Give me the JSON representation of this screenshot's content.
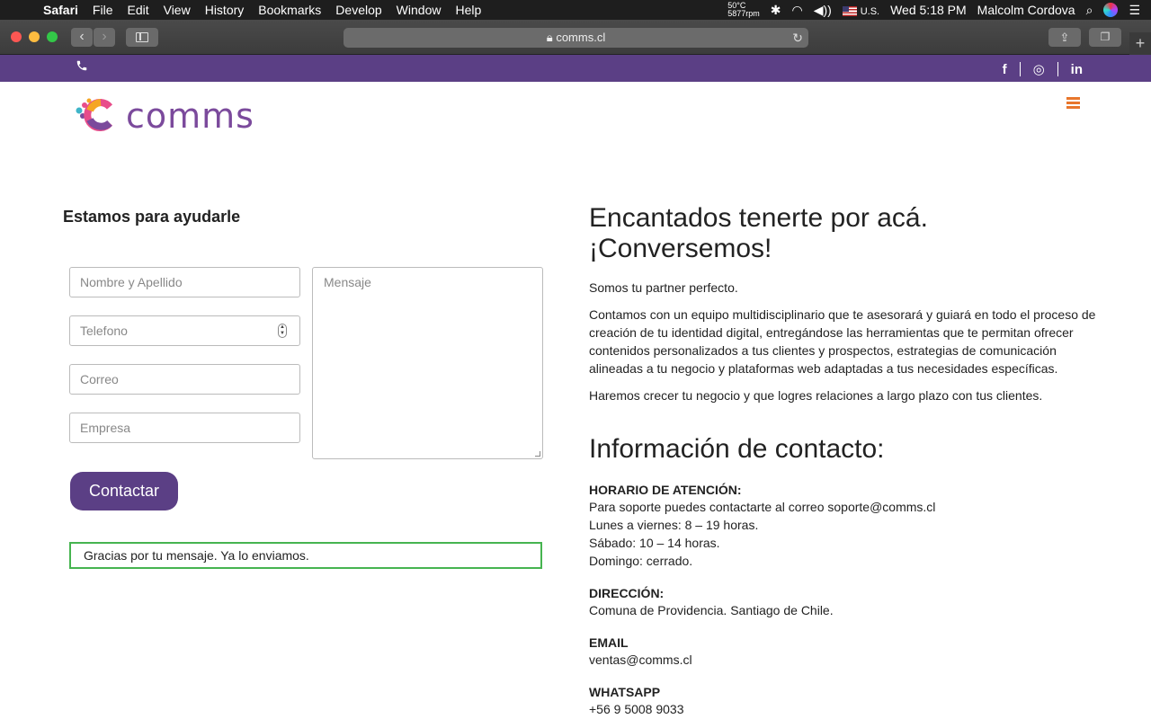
{
  "menubar": {
    "app": "Safari",
    "items": [
      "File",
      "Edit",
      "View",
      "History",
      "Bookmarks",
      "Develop",
      "Window",
      "Help"
    ],
    "temp": "50°C",
    "rpm": "5877rpm",
    "input_source": "U.S.",
    "clock": "Wed 5:18 PM",
    "user": "Malcolm Cordova"
  },
  "browser": {
    "url": "comms.cl"
  },
  "topbar": {
    "social": [
      "f",
      "◎",
      "in"
    ]
  },
  "logo": {
    "text": "comms"
  },
  "form": {
    "title": "Estamos para ayudarle",
    "fields": [
      "Nombre y Apellido",
      "Telefono",
      "Correo",
      "Empresa"
    ],
    "message_placeholder": "Mensaje",
    "submit": "Contactar",
    "success": "Gracias por tu mensaje. Ya lo enviamos."
  },
  "intro": {
    "headline_1": "Encantados tenerte por acá.",
    "headline_2": "¡Conversemos!",
    "p1": "Somos tu partner perfecto.",
    "p2": "Contamos con un equipo multidisciplinario que te asesorará y guiará en todo el proceso de creación de tu identidad digital, entregándose las herramientas que te permitan ofrecer contenidos personalizados a tus clientes y prospectos, estrategias de comunicación alineadas a tu negocio y plataformas web adaptadas a tus necesidades específicas.",
    "p3": "Haremos crecer tu negocio y que logres relaciones a largo plazo con tus clientes."
  },
  "contact": {
    "title": "Información de contacto:",
    "hours_title": "HORARIO DE ATENCIÓN:",
    "hours_1": "Para soporte puedes contactarte al correo soporte@comms.cl",
    "hours_2": "Lunes a viernes: 8 – 19 horas.",
    "hours_3": "Sábado: 10 – 14 horas.",
    "hours_4": "Domingo: cerrado.",
    "address_title": "DIRECCIÓN:",
    "address": "Comuna de Providencia. Santiago de Chile.",
    "email_title": "EMAIL",
    "email": "ventas@comms.cl",
    "whatsapp_title": "WHATSAPP",
    "whatsapp": "+56 9 5008 9033"
  }
}
